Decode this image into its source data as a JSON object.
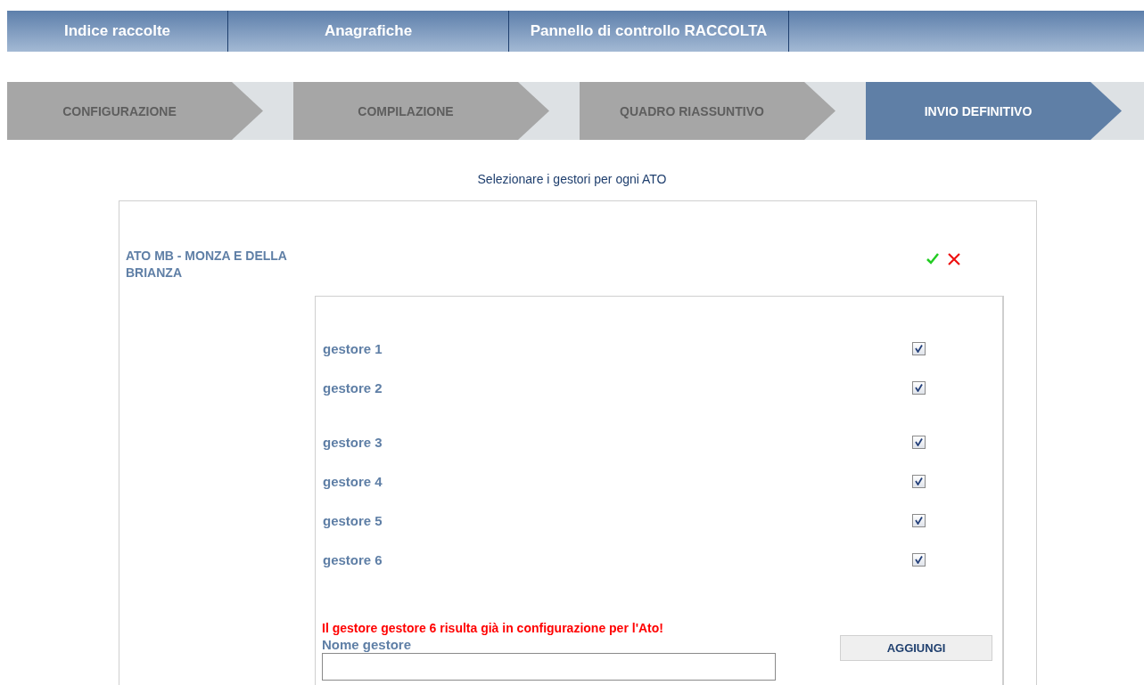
{
  "nav_tabs": [
    {
      "label": "Indice raccolte"
    },
    {
      "label": "Anagrafiche"
    },
    {
      "label": "Pannello di controllo RACCOLTA"
    }
  ],
  "steps": [
    {
      "label": "CONFIGURAZIONE",
      "selected": false
    },
    {
      "label": "COMPILAZIONE",
      "selected": false
    },
    {
      "label": "QUADRO RIASSUNTIVO",
      "selected": false
    },
    {
      "label": "INVIO DEFINITIVO",
      "selected": true
    }
  ],
  "subtitle": "Selezionare i gestori per ogni ATO",
  "ato": {
    "name": "ATO MB - MONZA E DELLA BRIANZA",
    "gestori": [
      {
        "label": "gestore 1",
        "checked": true
      },
      {
        "label": "gestore 2",
        "checked": true
      },
      {
        "label": "gestore 3",
        "checked": true
      },
      {
        "label": "gestore 4",
        "checked": true
      },
      {
        "label": "gestore 5",
        "checked": true
      },
      {
        "label": "gestore 6",
        "checked": true
      }
    ],
    "error": "Il gestore gestore 6 risulta già in configurazione per l'Ato!",
    "name_label": "Nome gestore",
    "add_button": "AGGIUNGI"
  }
}
